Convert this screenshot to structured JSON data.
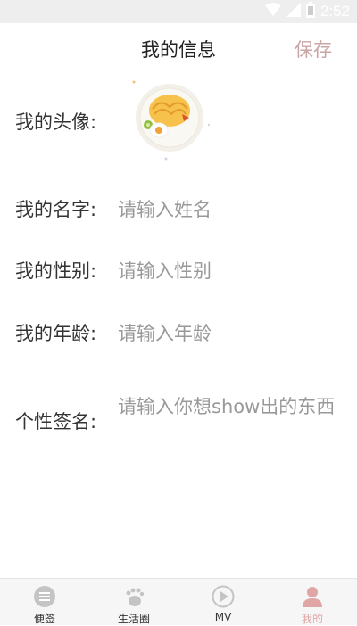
{
  "status_bar": {
    "time": "2:52"
  },
  "header": {
    "title": "我的信息",
    "save_label": "保存"
  },
  "form": {
    "avatar_label": "我的头像:",
    "name_label": "我的名字:",
    "name_placeholder": "请输入姓名",
    "gender_label": "我的性别:",
    "gender_placeholder": "请输入性别",
    "age_label": "我的年龄:",
    "age_placeholder": "请输入年龄",
    "signature_label": "个性签名:",
    "signature_placeholder": "请输入你想show出的东西"
  },
  "tabs": [
    {
      "label": "便签",
      "icon": "list-icon",
      "active": false
    },
    {
      "label": "生活圈",
      "icon": "footprint-icon",
      "active": false
    },
    {
      "label": "MV",
      "icon": "play-icon",
      "active": false
    },
    {
      "label": "我的",
      "icon": "person-icon",
      "active": true
    }
  ],
  "colors": {
    "accent": "#e0a5a5",
    "save": "#c9a6a6",
    "placeholder": "#999999"
  }
}
